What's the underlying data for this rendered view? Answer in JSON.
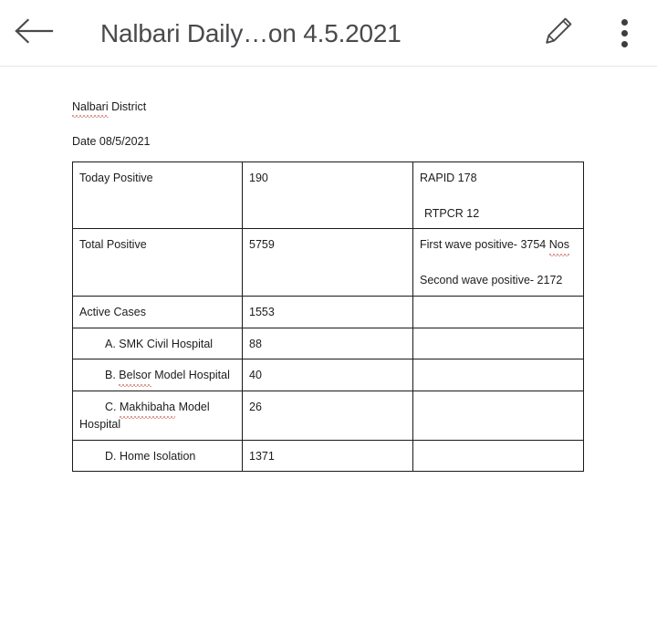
{
  "appbar": {
    "back_icon": "back-arrow-icon",
    "title": "Nalbari Daily…on 4.5.2021",
    "edit_icon": "pencil-icon",
    "menu_icon": "more-vertical-icon"
  },
  "document": {
    "heading": "Nalbari District",
    "date_line": "Date 08/5/2021",
    "table": {
      "rows": [
        {
          "label": "Today Positive",
          "value": "190",
          "notes": [
            "RAPID 178",
            "RTPCR 12"
          ]
        },
        {
          "label": "Total Positive",
          "value": "5759",
          "notes": [
            "First wave positive- 3754 Nos",
            "Second wave positive- 2172"
          ]
        },
        {
          "label": "Active Cases",
          "value": "1553",
          "notes": []
        },
        {
          "label": "A. SMK Civil Hospital",
          "value": "88",
          "notes": []
        },
        {
          "label": "B. Belsor Model Hospital",
          "value": "40",
          "notes": []
        },
        {
          "label_line1": "C. Makhibaha Model",
          "label_line2": "Hospital",
          "value": "26",
          "notes": []
        },
        {
          "label": "D. Home Isolation",
          "value": "1371",
          "notes": []
        }
      ]
    },
    "spellcheck_words": [
      "Nalbari",
      "Nos",
      "Belsor",
      "Makhibaha"
    ]
  },
  "colors": {
    "text": "#1c1c1c",
    "title": "#4a4a4d",
    "icon": "#3d3d3f",
    "table_border": "#1a1a1a",
    "spellcheck": "#bc3b30",
    "appbar_bg": "#ffffff",
    "page_bg": "#ffffff"
  }
}
